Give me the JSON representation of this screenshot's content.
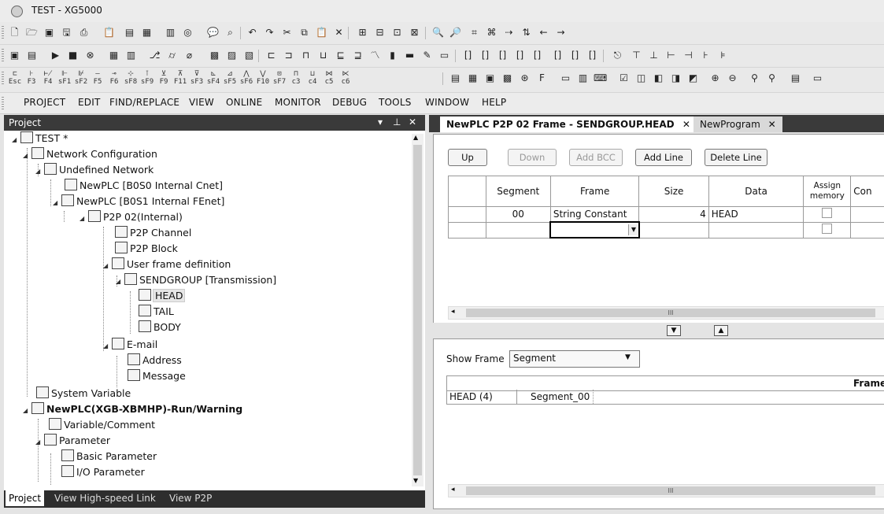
{
  "window": {
    "title": "TEST - XG5000"
  },
  "toolbar3_fkeys": [
    "Esc",
    "F3",
    "F4",
    "sF1",
    "sF2",
    "F5",
    "F6",
    "sF8",
    "sF9",
    "F9",
    "F11",
    "sF3",
    "sF4",
    "sF5",
    "sF6",
    "F10",
    "sF7",
    "c3",
    "c4",
    "c5",
    "c6"
  ],
  "menu": [
    "PROJECT",
    "EDIT",
    "FIND/REPLACE",
    "VIEW",
    "ONLINE",
    "MONITOR",
    "DEBUG",
    "TOOLS",
    "WINDOW",
    "HELP"
  ],
  "project_pane": {
    "title": "Project",
    "tree": [
      {
        "label": "TEST *"
      },
      {
        "label": "Network Configuration"
      },
      {
        "label": "Undefined Network"
      },
      {
        "label": "NewPLC [B0S0 Internal Cnet]"
      },
      {
        "label": "NewPLC [B0S1 Internal FEnet]"
      },
      {
        "label": "P2P 02(Internal)"
      },
      {
        "label": "P2P Channel"
      },
      {
        "label": "P2P Block"
      },
      {
        "label": "User frame definition"
      },
      {
        "label": "SENDGROUP [Transmission]"
      },
      {
        "label": "HEAD"
      },
      {
        "label": "TAIL"
      },
      {
        "label": "BODY"
      },
      {
        "label": "E-mail"
      },
      {
        "label": "Address"
      },
      {
        "label": "Message"
      },
      {
        "label": "System Variable"
      },
      {
        "label": "NewPLC(XGB-XBMHP)-Run/Warning"
      },
      {
        "label": "Variable/Comment"
      },
      {
        "label": "Parameter"
      },
      {
        "label": "Basic Parameter"
      },
      {
        "label": "I/O Parameter"
      }
    ],
    "tabs": [
      "Project",
      "View High-speed Link",
      "View P2P"
    ]
  },
  "doc_tabs": [
    {
      "label": "NewPLC P2P 02 Frame - SENDGROUP.HEAD"
    },
    {
      "label": "NewProgram"
    }
  ],
  "frame_editor": {
    "buttons": {
      "up": "Up",
      "down": "Down",
      "add_bcc": "Add BCC",
      "add_line": "Add Line",
      "delete_line": "Delete Line"
    },
    "columns": [
      "Segment",
      "Frame",
      "Size",
      "Data",
      "Assign memory",
      "Con"
    ],
    "rows": [
      {
        "segment": "00",
        "frame": "String Constant",
        "size": "4",
        "data": "HEAD"
      }
    ],
    "scroll_glyph": "III"
  },
  "lower": {
    "show_frame_label": "Show Frame",
    "show_frame_value": "Segment",
    "col_header": "Frame",
    "row_name": "HEAD (4)",
    "row_segment": "Segment_00",
    "scroll_glyph": "III"
  }
}
